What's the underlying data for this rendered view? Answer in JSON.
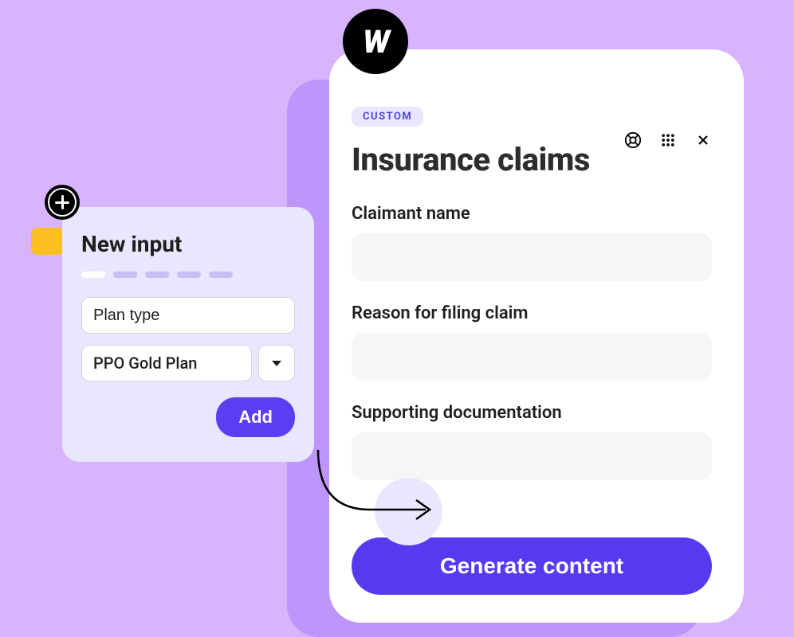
{
  "mainCard": {
    "badge": "CUSTOM",
    "title": "Insurance claims",
    "fields": [
      {
        "label": "Claimant name",
        "value": ""
      },
      {
        "label": "Reason for filing claim",
        "value": ""
      },
      {
        "label": "Supporting documentation",
        "value": ""
      }
    ],
    "generateButton": "Generate content"
  },
  "newInput": {
    "title": "New input",
    "fieldName": "Plan type",
    "dropdownValue": "PPO Gold Plan",
    "addButton": "Add"
  },
  "logo": {
    "text": "W"
  }
}
